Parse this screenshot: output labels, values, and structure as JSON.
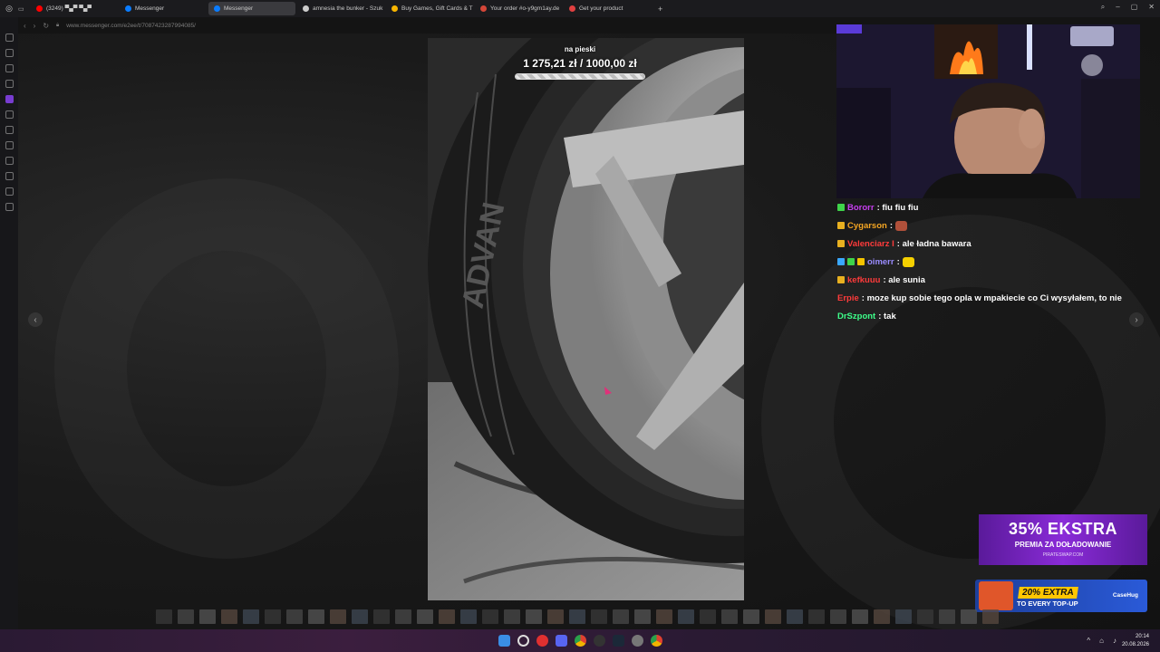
{
  "tabs": [
    {
      "label": "(3249) ▀▄▀ ▀▄▀",
      "fav_color": "#ff0000"
    },
    {
      "label": "Messenger",
      "fav_color": "#0a7cff"
    },
    {
      "label": "Messenger",
      "fav_color": "#0a7cff",
      "active": true
    },
    {
      "label": "amnesia the bunker - Szuk",
      "fav_color": "#cccccc"
    },
    {
      "label": "Buy Games, Gift Cards & T",
      "fav_color": "#f7b500"
    },
    {
      "label": "Your order #o-y9gm1ay.de",
      "fav_color": "#d44638"
    },
    {
      "label": "Get your product",
      "fav_color": "#e04040"
    }
  ],
  "address": {
    "url": "www.messenger.com/e2ee/t/7087423287994085/"
  },
  "goal": {
    "label": "na pieski",
    "current": "1 275,21 zł",
    "target": "1000,00 zł",
    "progress": 1.0
  },
  "chat": [
    {
      "user": "Bororr",
      "user_color": "#c73ff0",
      "text": ": fiu fiu fiu",
      "badges": [
        "#3fd44a"
      ]
    },
    {
      "user": "Cygarson",
      "user_color": "#f5a623",
      "text": ":",
      "badges": [
        "#e8b020"
      ],
      "emote": "#b0503a"
    },
    {
      "user": "Valenciarz I",
      "user_color": "#ff3b3b",
      "text": ": ale ładna bawara",
      "badges": [
        "#e8b020"
      ]
    },
    {
      "user": "oimerr",
      "user_color": "#9a8cff",
      "text": ":",
      "badges": [
        "#3aa8ff",
        "#3fd44a",
        "#f5c400"
      ],
      "emote": "#f5d000"
    },
    {
      "user": "kefkuuu",
      "user_color": "#ff3b3b",
      "text": ": ale sunia",
      "badges": [
        "#e8b020"
      ]
    },
    {
      "user": "Erpie",
      "user_color": "#ff3b3b",
      "text": ": moze kup sobie tego opla w mpakiecie co Ci wysyłałem, to nie",
      "badges": []
    },
    {
      "user": "DrSzpont",
      "user_color": "#3dff8a",
      "text": ": tak",
      "badges": []
    }
  ],
  "ads": {
    "ad1": {
      "big": "35% EKSTRA",
      "sub": "PREMIA ZA DOŁADOWANIE",
      "url": "PIRATESWAP.COM"
    },
    "ad2": {
      "pct": "20% EXTRA",
      "every": "TO EVERY TOP-UP",
      "brand": "CaseHug"
    }
  },
  "clock": {
    "time": "20:14",
    "date": "20.08.2026"
  },
  "colors": {
    "accent": "#9146ff",
    "taskbar": "#3b1e3e"
  }
}
